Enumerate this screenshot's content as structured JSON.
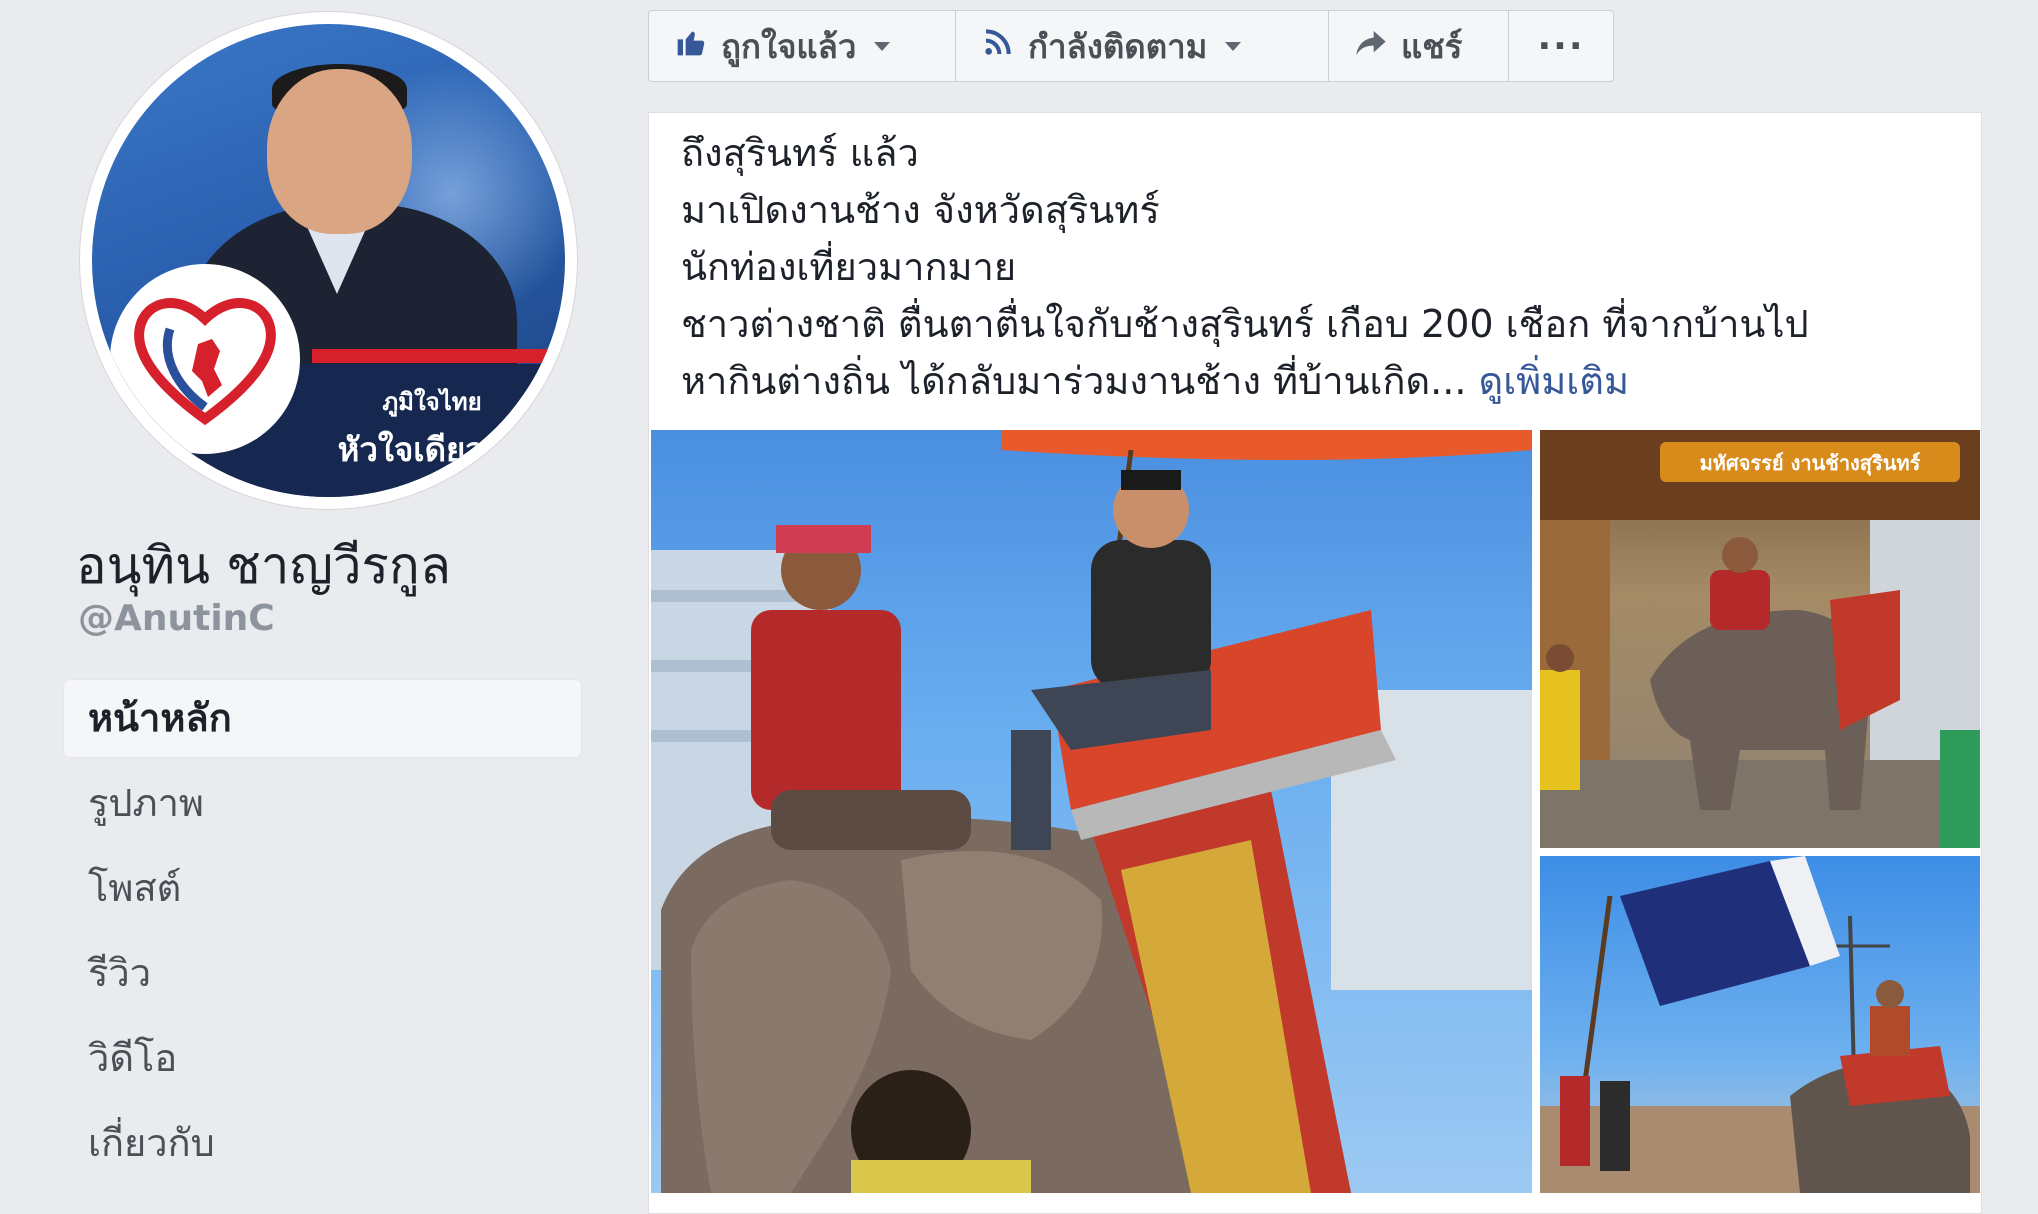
{
  "profile": {
    "name": "อนุทิน ชาญวีรกูล",
    "handle": "@AnutinC",
    "slogan_line1": "ภูมิใจไทย",
    "slogan_line2": "หัวใจเดียวกัน"
  },
  "nav": {
    "items": [
      {
        "label": "หน้าหลัก",
        "active": true
      },
      {
        "label": "รูปภาพ"
      },
      {
        "label": "โพสต์"
      },
      {
        "label": "รีวิว"
      },
      {
        "label": "วิดีโอ"
      },
      {
        "label": "เกี่ยวกับ"
      }
    ]
  },
  "actions": {
    "like_label": "ถูกใจแล้ว",
    "follow_label": "กำลังติดตาม",
    "share_label": "แชร์",
    "more_label": "···"
  },
  "post": {
    "lines": [
      "ถึงสุรินทร์ แล้ว",
      "มาเปิดงานช้าง จังหวัดสุรินทร์",
      "นักท่องเที่ยวมากมาย",
      "ชาวต่างชาติ ตื่นตาตื่นใจกับช้างสุรินทร์ เกือบ 200 เชือก ที่จากบ้านไป",
      "หากินต่างถิ่น ได้กลับมาร่วมงานช้าง ที่บ้านเกิด..."
    ],
    "see_more": "ดูเพิ่มเติม",
    "banner_text": "มหัศจรรย์ งานช้างสุรินทร์"
  },
  "colors": {
    "accent": "#365899",
    "background": "#e9ebee",
    "party_red": "#d6202b",
    "party_navy": "#16284f"
  },
  "icons": {
    "like": "thumbs-up-icon",
    "follow": "rss-icon",
    "share": "share-arrow-icon",
    "more": "more-dots-icon"
  }
}
